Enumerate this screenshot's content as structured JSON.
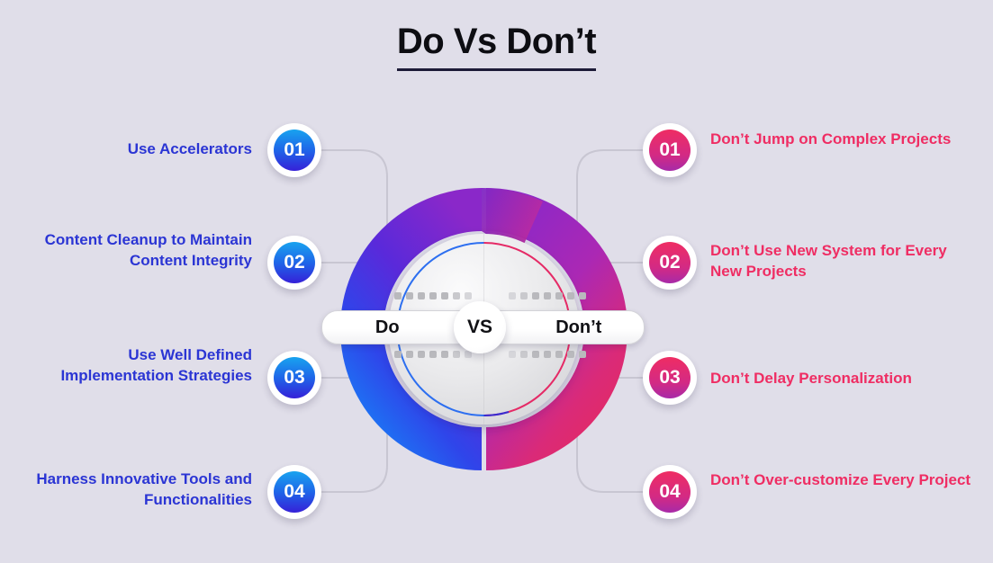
{
  "title": "Do Vs Don’t",
  "colors": {
    "background": "#e0dee9",
    "title": "#0d0d12",
    "do_accent": "#2b35d4",
    "dont_accent": "#ef2d63",
    "donut_left_top": "#7a2bc7",
    "donut_left_bottom": "#1a8cf5",
    "donut_right_top": "#8a28c9",
    "donut_right_bottom": "#e8295f",
    "connector": "#c8c6d2"
  },
  "center": {
    "do_label": "Do",
    "vs_label": "VS",
    "dont_label": "Don’t"
  },
  "do_side": {
    "heading": "Do",
    "items": [
      {
        "number": "01",
        "text": "Use Accelerators"
      },
      {
        "number": "02",
        "text": "Content Cleanup to Maintain Content Integrity"
      },
      {
        "number": "03",
        "text": "Use Well Defined Implementation Strategies"
      },
      {
        "number": "04",
        "text": "Harness Innovative Tools and Functionalities"
      }
    ]
  },
  "dont_side": {
    "heading": "Don’t",
    "items": [
      {
        "number": "01",
        "text": "Don’t Jump on Complex Projects"
      },
      {
        "number": "02",
        "text": "Don’t Use New System for Every New Projects"
      },
      {
        "number": "03",
        "text": "Don’t Delay Personalization"
      },
      {
        "number": "04",
        "text": "Don’t Over-customize Every Project"
      }
    ]
  }
}
